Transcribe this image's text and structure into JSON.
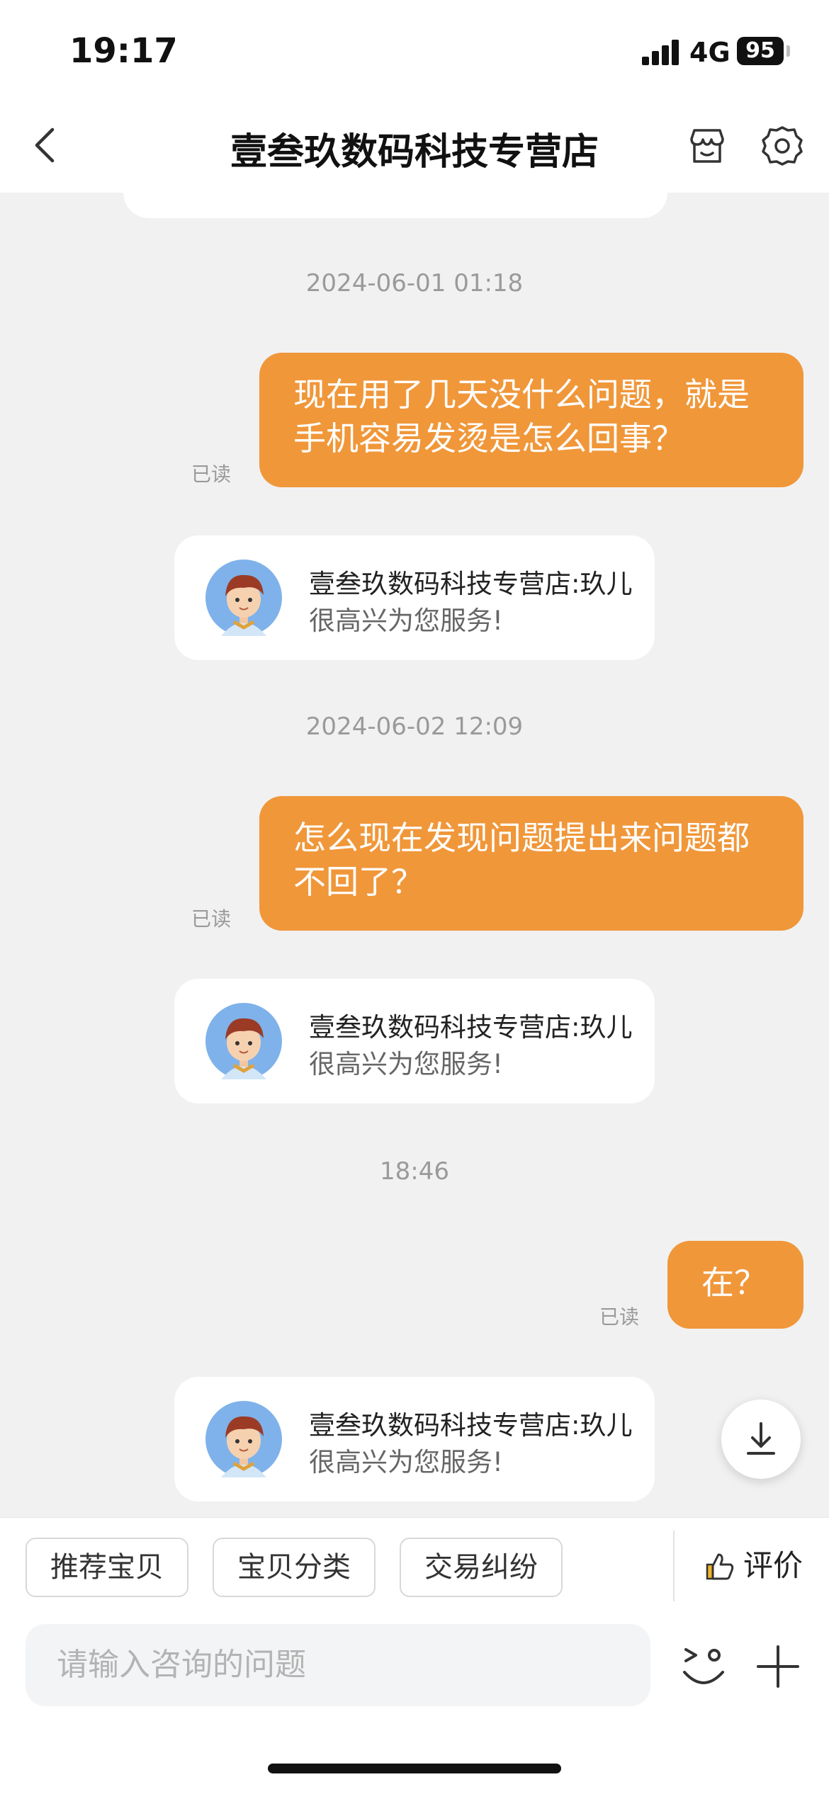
{
  "status_bar": {
    "time": "19:17",
    "network": "4G",
    "battery": "95"
  },
  "header": {
    "title": "壹叁玖数码科技专营店"
  },
  "chat": {
    "timestamps": [
      "2024-06-01 01:18",
      "2024-06-02 12:09",
      "18:46"
    ],
    "messages": [
      {
        "text": "现在用了几天没什么问题，就是手机容易发烫是怎么回事？",
        "status": "已读"
      },
      {
        "text": "怎么现在发现问题提出来问题都不回了？",
        "status": "已读"
      },
      {
        "text": "在？",
        "status": "已读"
      }
    ],
    "auto_replies": [
      {
        "name": "壹叁玖数码科技专营店:玖儿",
        "text": "很高兴为您服务!"
      },
      {
        "name": "壹叁玖数码科技专营店:玖儿",
        "text": "很高兴为您服务!"
      },
      {
        "name": "壹叁玖数码科技专营店:玖儿",
        "text": "很高兴为您服务!"
      }
    ]
  },
  "quick_actions": {
    "recommend": "推荐宝贝",
    "category": "宝贝分类",
    "dispute": "交易纠纷",
    "rate": "评价"
  },
  "input": {
    "placeholder": "请输入咨询的问题"
  },
  "icons": [
    "back-icon",
    "store-icon",
    "gear-icon",
    "scroll-down-icon",
    "thumbs-up-icon",
    "emoji-icon",
    "plus-icon"
  ],
  "colors": {
    "accent": "#f0973a",
    "background": "#f1f1f1"
  }
}
